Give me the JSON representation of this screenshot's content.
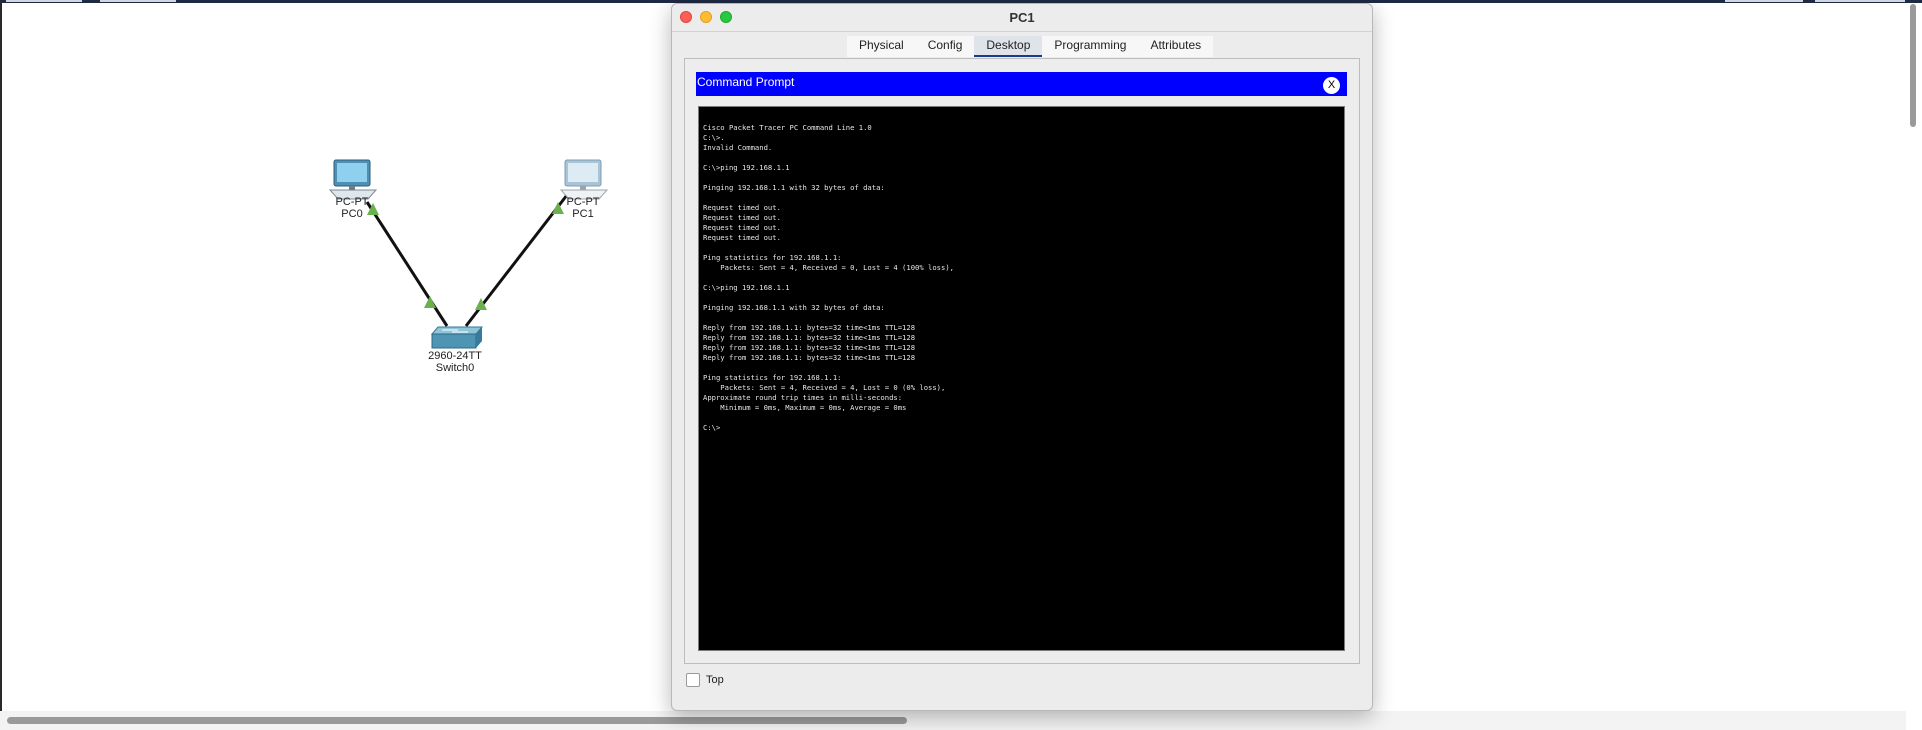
{
  "topology": {
    "devices": [
      {
        "type_label": "PC-PT",
        "name_label": "PC0",
        "icon": "pc-icon"
      },
      {
        "type_label": "PC-PT",
        "name_label": "PC1",
        "icon": "pc-icon"
      },
      {
        "type_label": "2960-24TT",
        "name_label": "Switch0",
        "icon": "switch-icon"
      }
    ],
    "link_status_color": "#6ab04c"
  },
  "window": {
    "title": "PC1",
    "tabs": [
      "Physical",
      "Config",
      "Desktop",
      "Programming",
      "Attributes"
    ],
    "active_tab": "Desktop",
    "command_prompt": {
      "title": "Command Prompt",
      "close_label": "X",
      "header_color": "#0000ff",
      "lines": [
        "Cisco Packet Tracer PC Command Line 1.0",
        "C:\\>.",
        "Invalid Command.",
        "",
        "C:\\>ping 192.168.1.1",
        "",
        "Pinging 192.168.1.1 with 32 bytes of data:",
        "",
        "Request timed out.",
        "Request timed out.",
        "Request timed out.",
        "Request timed out.",
        "",
        "Ping statistics for 192.168.1.1:",
        "    Packets: Sent = 4, Received = 0, Lost = 4 (100% loss),",
        "",
        "C:\\>ping 192.168.1.1",
        "",
        "Pinging 192.168.1.1 with 32 bytes of data:",
        "",
        "Reply from 192.168.1.1: bytes=32 time<1ms TTL=128",
        "Reply from 192.168.1.1: bytes=32 time<1ms TTL=128",
        "Reply from 192.168.1.1: bytes=32 time<1ms TTL=128",
        "Reply from 192.168.1.1: bytes=32 time<1ms TTL=128",
        "",
        "Ping statistics for 192.168.1.1:",
        "    Packets: Sent = 4, Received = 4, Lost = 0 (0% loss),",
        "Approximate round trip times in milli-seconds:",
        "    Minimum = 0ms, Maximum = 0ms, Average = 0ms",
        "",
        "C:\\>"
      ]
    },
    "top_checkbox_label": "Top",
    "top_checked": false
  }
}
